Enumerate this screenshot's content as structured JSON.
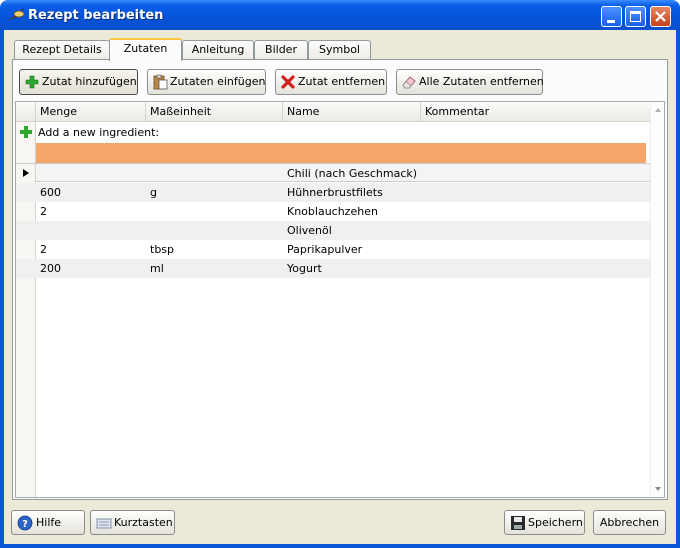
{
  "window": {
    "title": "Rezept bearbeiten"
  },
  "tabs": [
    {
      "label": "Rezept Details"
    },
    {
      "label": "Zutaten"
    },
    {
      "label": "Anleitung"
    },
    {
      "label": "Bilder"
    },
    {
      "label": "Symbol"
    }
  ],
  "toolbar": {
    "add_label": "Zutat hinzufügen",
    "insert_label": "Zutaten einfügen",
    "remove_label": "Zutat entfernen",
    "remove_all_label": "Alle Zutaten entfernen"
  },
  "grid": {
    "columns": [
      "Menge",
      "Maßeinheit",
      "Name",
      "Kommentar"
    ],
    "new_row_text": "Add a new ingredient:",
    "rows": [
      {
        "menge": "",
        "einheit": "",
        "name": "Chili (nach Geschmack)",
        "kommentar": ""
      },
      {
        "menge": "600",
        "einheit": "g",
        "name": "Hühnerbrustfilets",
        "kommentar": ""
      },
      {
        "menge": "2",
        "einheit": "",
        "name": "Knoblauchzehen",
        "kommentar": ""
      },
      {
        "menge": "",
        "einheit": "",
        "name": "Olivenöl",
        "kommentar": ""
      },
      {
        "menge": "2",
        "einheit": "tbsp",
        "name": "Paprikapulver",
        "kommentar": ""
      },
      {
        "menge": "200",
        "einheit": "ml",
        "name": "Yogurt",
        "kommentar": ""
      }
    ]
  },
  "bottom": {
    "help_label": "Hilfe",
    "shortcuts_label": "Kurztasten",
    "save_label": "Speichern",
    "cancel_label": "Abbrechen"
  },
  "colors": {
    "titlebar": "#0552d8",
    "new_row_highlight": "#f5a66b",
    "active_tab_accent": "#ffc83c"
  }
}
